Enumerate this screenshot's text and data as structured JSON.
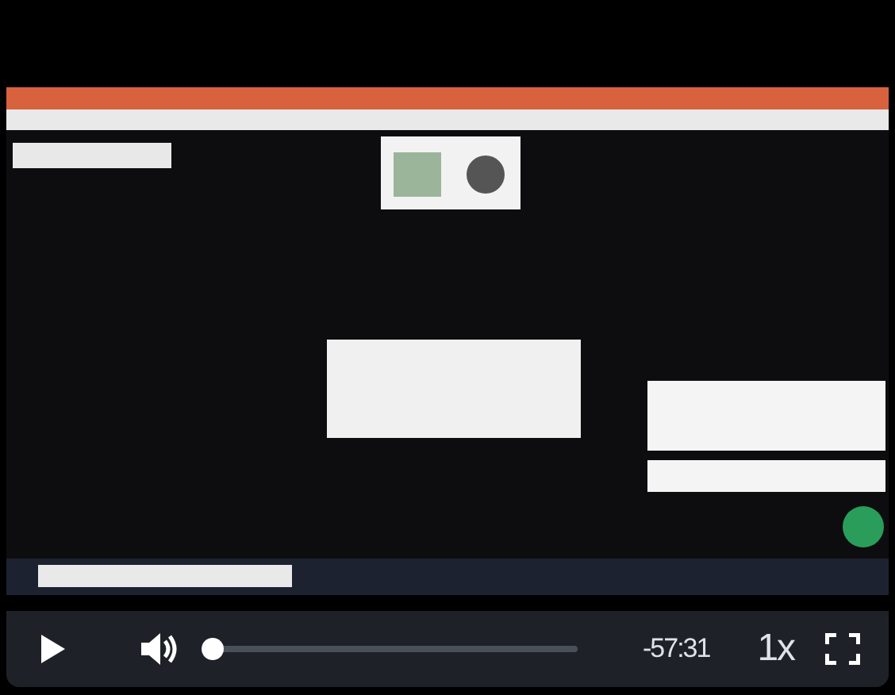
{
  "controls": {
    "playing": false,
    "muted": false,
    "progress": {
      "level": 0
    },
    "time_remaining": "-57:31",
    "speed": "1x"
  }
}
